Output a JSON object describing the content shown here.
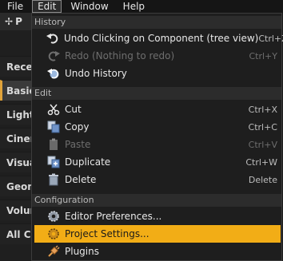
{
  "menubar": {
    "items": [
      {
        "label": "File"
      },
      {
        "label": "Edit"
      },
      {
        "label": "Window"
      },
      {
        "label": "Help"
      }
    ]
  },
  "background_panel": {
    "header_text": "P",
    "items": [
      "Recen",
      "Basic",
      "Lights",
      "Cinem",
      "Visua",
      "Geom",
      "Volun",
      "All Cla"
    ],
    "selected_index": 1
  },
  "edit_menu": {
    "sections": [
      {
        "title": "History",
        "items": [
          {
            "label": "Undo Clicking on Component (tree view)",
            "shortcut": "Ctrl+Z",
            "icon": "undo-icon",
            "enabled": true
          },
          {
            "label": "Redo (Nothing to redo)",
            "shortcut": "Ctrl+Y",
            "icon": "redo-icon",
            "enabled": false
          },
          {
            "label": "Undo History",
            "shortcut": "",
            "icon": "undo-history-icon",
            "enabled": true
          }
        ]
      },
      {
        "title": "Edit",
        "items": [
          {
            "label": "Cut",
            "shortcut": "Ctrl+X",
            "icon": "scissors-icon",
            "enabled": true
          },
          {
            "label": "Copy",
            "shortcut": "Ctrl+C",
            "icon": "copy-icon",
            "enabled": true
          },
          {
            "label": "Paste",
            "shortcut": "Ctrl+V",
            "icon": "paste-icon",
            "enabled": false
          },
          {
            "label": "Duplicate",
            "shortcut": "Ctrl+W",
            "icon": "duplicate-icon",
            "enabled": true
          },
          {
            "label": "Delete",
            "shortcut": "Delete",
            "icon": "delete-icon",
            "enabled": true
          }
        ]
      },
      {
        "title": "Configuration",
        "items": [
          {
            "label": "Editor Preferences...",
            "shortcut": "",
            "icon": "editor-preferences-icon",
            "enabled": true
          },
          {
            "label": "Project Settings...",
            "shortcut": "",
            "icon": "project-settings-icon",
            "enabled": true,
            "highlighted": true
          },
          {
            "label": "Plugins",
            "shortcut": "",
            "icon": "plugins-icon",
            "enabled": true
          }
        ]
      }
    ]
  },
  "colors": {
    "highlight": "#f2ad16",
    "menu_bg": "#1e1e1e",
    "section_bg": "#2c2c2c"
  }
}
